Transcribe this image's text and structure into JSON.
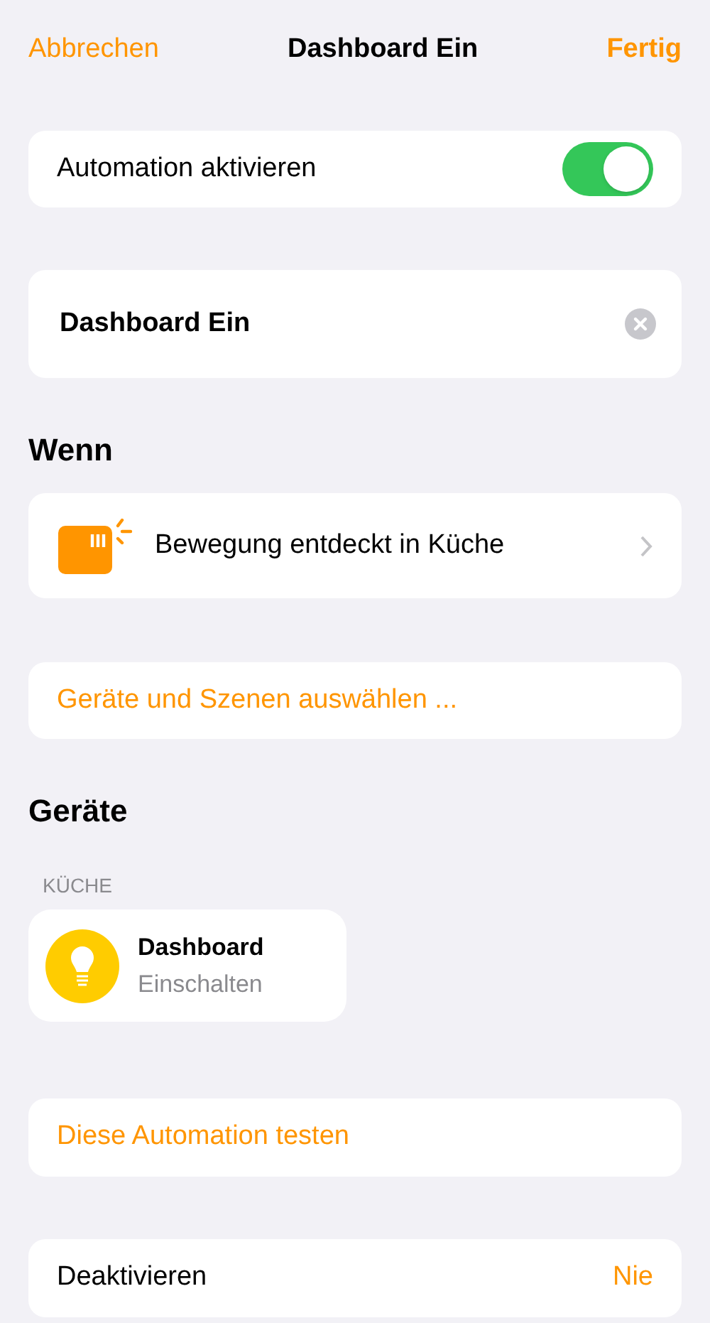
{
  "nav": {
    "cancel": "Abbrechen",
    "title": "Dashboard Ein",
    "done": "Fertig"
  },
  "enable": {
    "label": "Automation aktivieren",
    "on": true
  },
  "name_field": {
    "value": "Dashboard Ein"
  },
  "when": {
    "heading": "Wenn",
    "trigger": "Bewegung entdeckt in Küche"
  },
  "select_action": "Geräte und Szenen auswählen ...",
  "devices": {
    "heading": "Geräte",
    "room": "KÜCHE",
    "items": [
      {
        "name": "Dashboard",
        "action": "Einschalten"
      }
    ]
  },
  "test_action": "Diese Automation testen",
  "deactivate": {
    "label": "Deaktivieren",
    "value": "Nie"
  }
}
